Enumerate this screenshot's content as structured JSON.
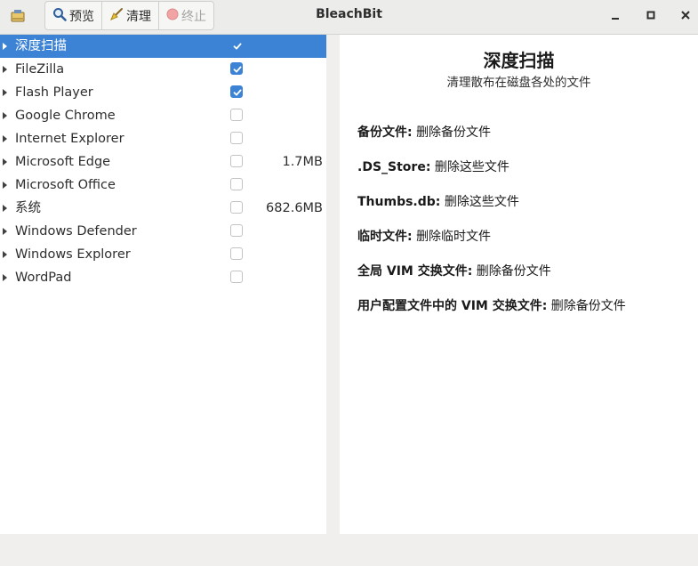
{
  "window": {
    "title": "BleachBit"
  },
  "toolbar": {
    "preview_label": "预览",
    "clean_label": "清理",
    "stop_label": "终止"
  },
  "cleaners": [
    {
      "label": "深度扫描",
      "checked": true,
      "size": "",
      "selected": true
    },
    {
      "label": "FileZilla",
      "checked": true,
      "size": ""
    },
    {
      "label": "Flash Player",
      "checked": true,
      "size": ""
    },
    {
      "label": "Google Chrome",
      "checked": false,
      "size": ""
    },
    {
      "label": "Internet Explorer",
      "checked": false,
      "size": ""
    },
    {
      "label": "Microsoft Edge",
      "checked": false,
      "size": "1.7MB"
    },
    {
      "label": "Microsoft Office",
      "checked": false,
      "size": ""
    },
    {
      "label": "系统",
      "checked": false,
      "size": "682.6MB"
    },
    {
      "label": "Windows Defender",
      "checked": false,
      "size": ""
    },
    {
      "label": "Windows Explorer",
      "checked": false,
      "size": ""
    },
    {
      "label": "WordPad",
      "checked": false,
      "size": ""
    }
  ],
  "detail": {
    "title": "深度扫描",
    "subtitle": "清理散布在磁盘各处的文件",
    "options": [
      {
        "name": "备份文件:",
        "desc": "删除备份文件"
      },
      {
        "name": ".DS_Store:",
        "desc": "删除这些文件"
      },
      {
        "name": "Thumbs.db:",
        "desc": "删除这些文件"
      },
      {
        "name": "临时文件:",
        "desc": "删除临时文件"
      },
      {
        "name": "全局 VIM 交换文件:",
        "desc": "删除备份文件"
      },
      {
        "name": "用户配置文件中的 VIM 交换文件:",
        "desc": "删除备份文件"
      }
    ]
  },
  "colors": {
    "accent": "#3c83d6",
    "stop_icon": "#e05656"
  }
}
